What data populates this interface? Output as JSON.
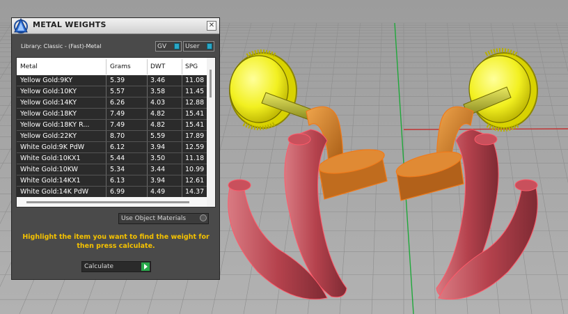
{
  "window": {
    "title": "METAL WEIGHTS",
    "close_glyph": "✕",
    "library_label": "Library: Classic - (Fast)-Metal",
    "toggles": {
      "gv_label": "GV",
      "user_label": "User"
    }
  },
  "table": {
    "columns": [
      "Metal",
      "Grams",
      "DWT",
      "SPG"
    ],
    "rows": [
      {
        "metal": "Yellow Gold:9KY",
        "grams": "5.39",
        "dwt": "3.46",
        "spg": "11.08"
      },
      {
        "metal": "Yellow Gold:10KY",
        "grams": "5.57",
        "dwt": "3.58",
        "spg": "11.45"
      },
      {
        "metal": "Yellow Gold:14KY",
        "grams": "6.26",
        "dwt": "4.03",
        "spg": "12.88"
      },
      {
        "metal": "Yellow Gold:18KY",
        "grams": "7.49",
        "dwt": "4.82",
        "spg": "15.41"
      },
      {
        "metal": "Yellow Gold:18KY R...",
        "grams": "7.49",
        "dwt": "4.82",
        "spg": "15.41"
      },
      {
        "metal": "Yellow Gold:22KY",
        "grams": "8.70",
        "dwt": "5.59",
        "spg": "17.89"
      },
      {
        "metal": "White Gold:9K PdW",
        "grams": "6.12",
        "dwt": "3.94",
        "spg": "12.59"
      },
      {
        "metal": "White Gold:10KX1",
        "grams": "5.44",
        "dwt": "3.50",
        "spg": "11.18"
      },
      {
        "metal": "White Gold:10KW",
        "grams": "5.34",
        "dwt": "3.44",
        "spg": "10.99"
      },
      {
        "metal": "White Gold:14KX1",
        "grams": "6.13",
        "dwt": "3.94",
        "spg": "12.61"
      },
      {
        "metal": "White Gold:14K PdW",
        "grams": "6.99",
        "dwt": "4.49",
        "spg": "14.37"
      }
    ]
  },
  "controls": {
    "use_object_materials": "Use Object Materials",
    "instruction": "Highlight the item you want to find the weight for then press calculate.",
    "calculate_label": "Calculate"
  },
  "colors": {
    "accent_text": "#f5c200",
    "viewport_bg": "#a6a6a6",
    "toggle_on": "#2aa7c6",
    "calculate_go": "#28a84a",
    "model_yellow": "#f0f020",
    "model_orange": "#d9852a",
    "model_red": "#c44a55"
  },
  "icons": {
    "app_icon": "triangle-app-icon",
    "close": "close-icon",
    "calculate": "play-arrow-icon"
  }
}
